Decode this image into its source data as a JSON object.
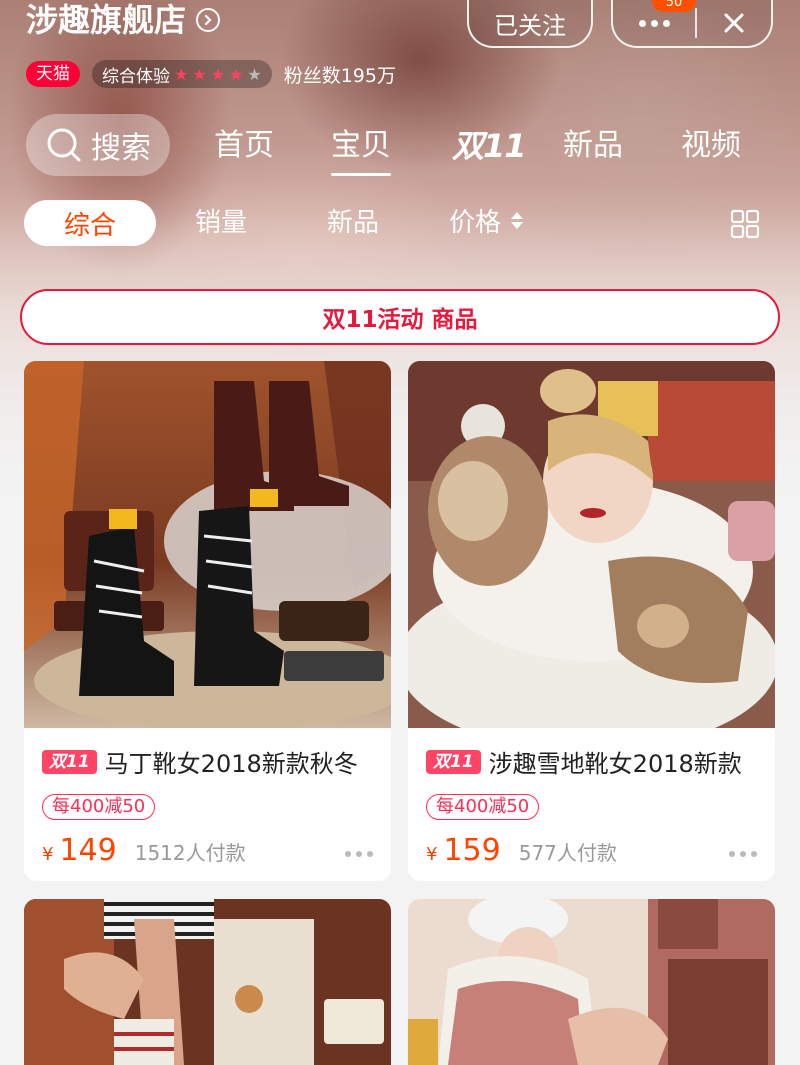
{
  "header": {
    "store_name": "涉趣旗舰店",
    "follow_label": "已关注",
    "notification_count": "50",
    "tmall_label": "天猫",
    "experience_label": "综合体验",
    "experience_stars": 4,
    "fans_label": "粉丝数195万"
  },
  "nav": {
    "search_label": "搜索",
    "tabs": [
      "首页",
      "宝贝",
      "双11",
      "新品",
      "视频"
    ],
    "active_tab": "宝贝"
  },
  "sort": {
    "items": [
      "综合",
      "销量",
      "新品",
      "价格"
    ],
    "active": "综合"
  },
  "promo": {
    "title": "双11活动",
    "suffix": "商品"
  },
  "products": [
    {
      "tag": "双11",
      "title": "马丁靴女2018新款秋冬",
      "coupon": "每400减50",
      "currency": "¥",
      "price": "149",
      "sold": "1512人付款"
    },
    {
      "tag": "双11",
      "title": "涉趣雪地靴女2018新款",
      "coupon": "每400减50",
      "currency": "¥",
      "price": "159",
      "sold": "577人付款"
    }
  ],
  "colors": {
    "accent": "#ff4400",
    "tmall_red": "#ff0036",
    "promo_red": "#e6183c"
  }
}
